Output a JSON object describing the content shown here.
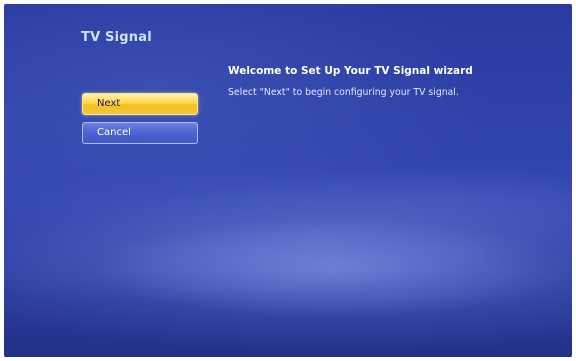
{
  "app": {
    "title": "TV Signal"
  },
  "wizard": {
    "heading": "Welcome to Set Up Your TV Signal wizard",
    "description": "Select \"Next\" to begin configuring your TV signal."
  },
  "buttons": {
    "next_label": "Next",
    "cancel_label": "Cancel"
  },
  "colors": {
    "background": "#2f43ab",
    "title_text": "#cfe0ff",
    "focused_button": "#ffd84a",
    "normal_button": "#4d63cf"
  }
}
